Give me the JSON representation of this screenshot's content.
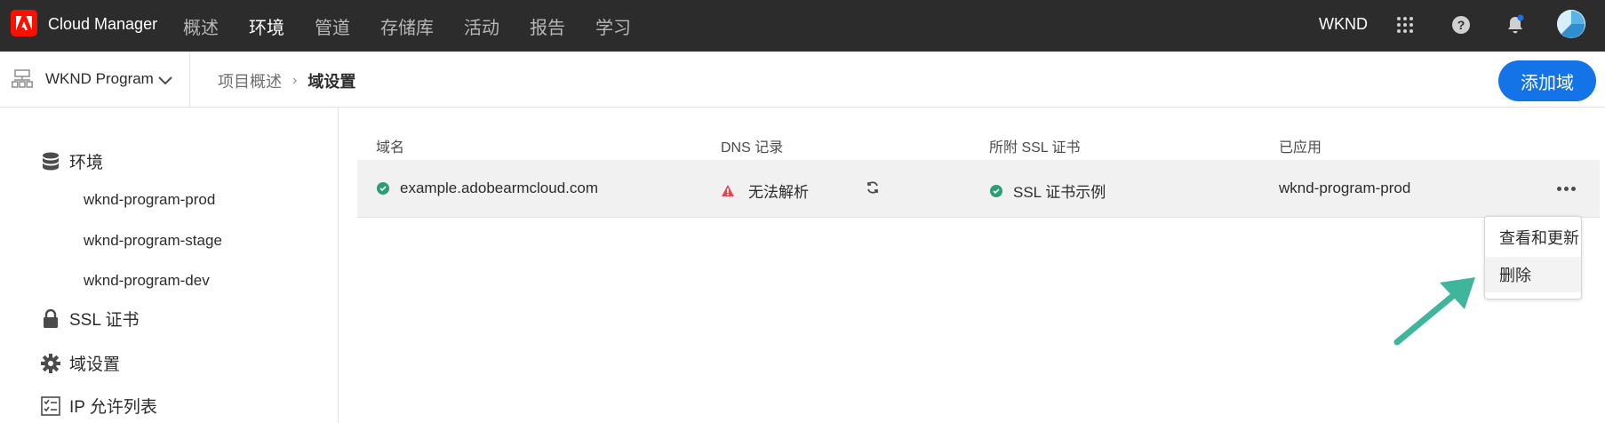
{
  "app": {
    "name": "Cloud Manager",
    "org": "WKND",
    "brand_color": "#fa0f00",
    "accent_color": "#1473e6"
  },
  "nav": {
    "items": [
      {
        "label": "概述"
      },
      {
        "label": "环境"
      },
      {
        "label": "管道"
      },
      {
        "label": "存储库"
      },
      {
        "label": "活动"
      },
      {
        "label": "报告"
      },
      {
        "label": "学习"
      }
    ],
    "active": "环境"
  },
  "topbar_icons": [
    "apps-grid-icon",
    "help-icon",
    "notifications-bell-icon",
    "user-avatar"
  ],
  "subbar": {
    "program": "WKND Program",
    "breadcrumb": [
      "项目概述",
      "域设置"
    ],
    "add_button": "添加域"
  },
  "sidebar": {
    "sections": [
      {
        "label": "环境",
        "icon": "database-icon",
        "items": [
          "wknd-program-prod",
          "wknd-program-stage",
          "wknd-program-dev"
        ]
      },
      {
        "label": "SSL 证书",
        "icon": "lock-icon"
      },
      {
        "label": "域设置",
        "icon": "gear-icon"
      },
      {
        "label": "IP 允许列表",
        "icon": "checklist-icon"
      }
    ]
  },
  "table": {
    "columns": [
      "域名",
      "DNS 记录",
      "所附 SSL 证书",
      "已应用"
    ],
    "rows": [
      {
        "domain": "example.adobearmcloud.com",
        "domain_status": "ok",
        "dns": "无法解析",
        "dns_status": "error",
        "ssl": "SSL 证书示例",
        "ssl_status": "ok",
        "applied": "wknd-program-prod"
      }
    ]
  },
  "menu": {
    "items": [
      "查看和更新",
      "删除"
    ],
    "highlighted": "删除"
  },
  "status_colors": {
    "ok": "#2d9d78",
    "error": "#e34850"
  },
  "annotation_arrow_color": "#3fb59c"
}
